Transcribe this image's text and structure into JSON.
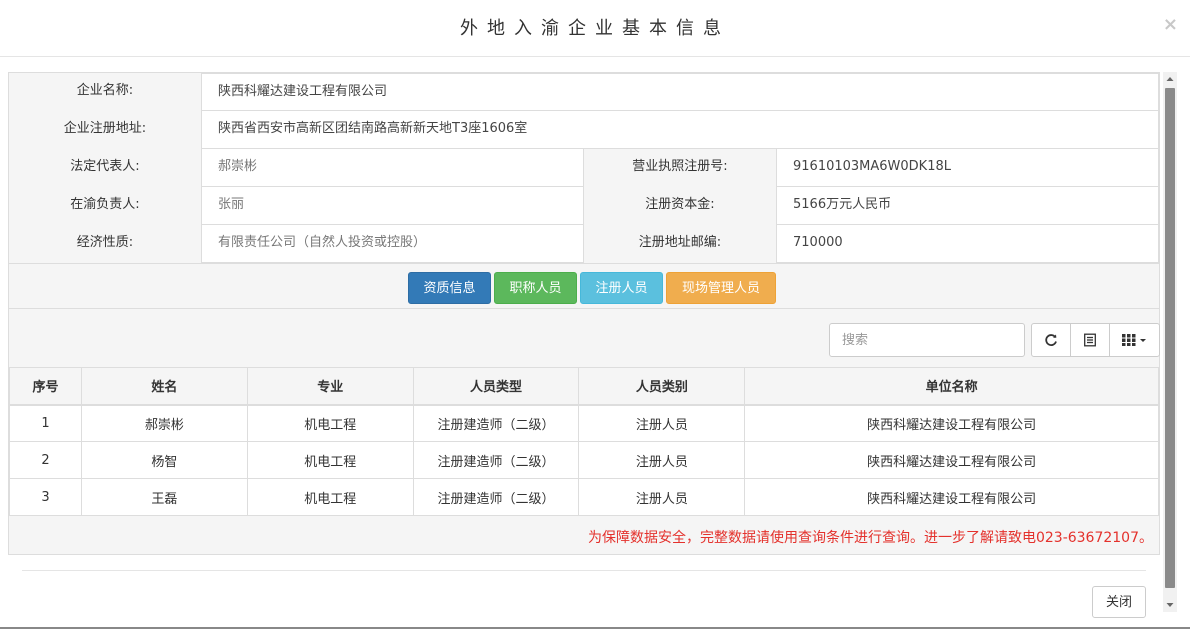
{
  "header": {
    "title": "外地入渝企业基本信息",
    "close_symbol": "×"
  },
  "info": {
    "company_name_label": "企业名称:",
    "company_name": "陕西科耀达建设工程有限公司",
    "address_label": "企业注册地址:",
    "address": "陕西省西安市高新区团结南路高新新天地T3座1606室",
    "legal_rep_label": "法定代表人:",
    "legal_rep": "郝崇彬",
    "license_label": "营业执照注册号:",
    "license": "91610103MA6W0DK18L",
    "local_head_label": "在渝负责人:",
    "local_head": "张丽",
    "capital_label": "注册资本金:",
    "capital": "5166万元人民币",
    "econ_label": "经济性质:",
    "econ": "有限责任公司（自然人投资或控股）",
    "postcode_label": "注册地址邮编:",
    "postcode": "710000"
  },
  "buttons": {
    "qualification": "资质信息",
    "titled": "职称人员",
    "registered": "注册人员",
    "site_mgmt": "现场管理人员"
  },
  "toolbar": {
    "search_placeholder": "搜索"
  },
  "table": {
    "columns": [
      "序号",
      "姓名",
      "专业",
      "人员类型",
      "人员类别",
      "单位名称"
    ],
    "rows": [
      [
        "1",
        "郝崇彬",
        "机电工程",
        "注册建造师（二级）",
        "注册人员",
        "陕西科耀达建设工程有限公司"
      ],
      [
        "2",
        "杨智",
        "机电工程",
        "注册建造师（二级）",
        "注册人员",
        "陕西科耀达建设工程有限公司"
      ],
      [
        "3",
        "王磊",
        "机电工程",
        "注册建造师（二级）",
        "注册人员",
        "陕西科耀达建设工程有限公司"
      ]
    ]
  },
  "notice": "为保障数据安全，完整数据请使用查询条件进行查询。进一步了解请致电023-63672107。",
  "footer": {
    "close_label": "关闭"
  },
  "colors": {
    "primary": "#337ab7",
    "success": "#5cb85c",
    "info": "#5bc0de",
    "warning": "#f0ad4e",
    "notice_red": "#e4312c"
  }
}
